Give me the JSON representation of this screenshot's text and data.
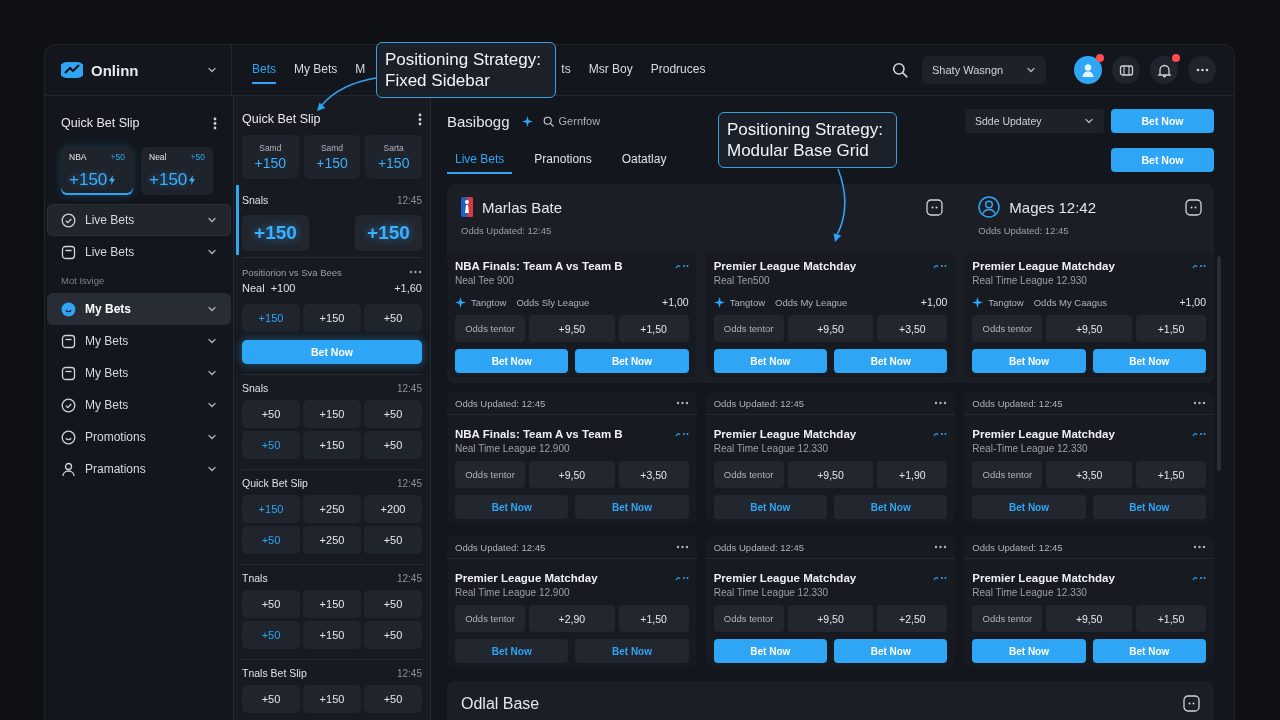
{
  "topbar": {
    "brand": "Onlinn",
    "nav": [
      {
        "label": "Bets",
        "selected": true
      },
      {
        "label": "My Bets",
        "selected": false
      },
      {
        "label": "M",
        "selected": false
      },
      {
        "label": "ts",
        "selected": false
      },
      {
        "label": "Msr Boy",
        "selected": false
      },
      {
        "label": "Prodruces",
        "selected": false
      }
    ],
    "user": "Shaty Wasngn",
    "icons": [
      {
        "kind": "avatar",
        "badge": true
      },
      {
        "kind": "ticket",
        "badge": false
      },
      {
        "kind": "bell",
        "badge": true
      },
      {
        "kind": "more",
        "badge": false
      }
    ]
  },
  "sidebar": {
    "title": "Quick Bet Slip",
    "tiles": [
      {
        "label": "NBA",
        "change": "+50",
        "odds": "+150",
        "selected": true
      },
      {
        "label": "Neal",
        "change": "+50",
        "odds": "+150",
        "selected": false
      }
    ],
    "items": [
      {
        "kind": "link",
        "label": "Live Bets",
        "selected": false,
        "highlighted": true
      },
      {
        "kind": "link",
        "label": "Live Bets",
        "selected": false,
        "highlighted": false
      },
      {
        "kind": "heading",
        "label": "Mot Isvige"
      },
      {
        "kind": "link",
        "label": "My Bets",
        "selected": true,
        "highlighted": false
      },
      {
        "kind": "link",
        "label": "My Bets",
        "selected": false,
        "highlighted": false
      },
      {
        "kind": "link",
        "label": "My Bets",
        "selected": false,
        "highlighted": false
      },
      {
        "kind": "link",
        "label": "My Bets",
        "selected": false,
        "highlighted": false
      },
      {
        "kind": "link",
        "label": "Promotions",
        "selected": false,
        "highlighted": false
      },
      {
        "kind": "link",
        "label": "Pramations",
        "selected": false,
        "highlighted": false
      }
    ]
  },
  "slip": {
    "title": "Quick Bet Slip",
    "tiles": [
      {
        "label": "Samd",
        "odds": "+150"
      },
      {
        "label": "Samd",
        "odds": "+150"
      },
      {
        "label": "Sarta",
        "odds": "+150"
      }
    ],
    "featured": {
      "title": "Snals",
      "time": "12:45",
      "odds": [
        "+150",
        "+150"
      ]
    },
    "position": {
      "title": "Positiorion vs Sva Bees",
      "pick": "Neal",
      "pick_odds": "+100",
      "total": "+1,60",
      "odds": [
        {
          "value": "+150",
          "selected": true
        },
        {
          "value": "+150",
          "selected": false
        },
        {
          "value": "+50",
          "selected": false
        }
      ],
      "button": "Bet Now"
    },
    "groups": [
      {
        "title": "Snals",
        "time": "12:45",
        "rows": [
          [
            {
              "value": "+50",
              "selected": false
            },
            {
              "value": "+150",
              "selected": false
            },
            {
              "value": "+50",
              "selected": false
            }
          ],
          [
            {
              "value": "+50",
              "selected": true
            },
            {
              "value": "+150",
              "selected": false
            },
            {
              "value": "+50",
              "selected": false
            }
          ]
        ]
      },
      {
        "title": "Quick Bet Slip",
        "time": "12:45",
        "rows": [
          [
            {
              "value": "+150",
              "selected": true
            },
            {
              "value": "+250",
              "selected": false
            },
            {
              "value": "+200",
              "selected": false
            }
          ],
          [
            {
              "value": "+50",
              "selected": true
            },
            {
              "value": "+250",
              "selected": false
            },
            {
              "value": "+50",
              "selected": false
            }
          ]
        ]
      },
      {
        "title": "Tnals",
        "time": "12:45",
        "rows": [
          [
            {
              "value": "+50",
              "selected": false
            },
            {
              "value": "+150",
              "selected": false
            },
            {
              "value": "+50",
              "selected": false
            }
          ],
          [
            {
              "value": "+50",
              "selected": true
            },
            {
              "value": "+150",
              "selected": false
            },
            {
              "value": "+50",
              "selected": false
            }
          ]
        ]
      },
      {
        "title": "Tnals Bet Slip",
        "time": "12:45",
        "rows": [
          [
            {
              "value": "+50",
              "selected": false
            },
            {
              "value": "+150",
              "selected": false
            },
            {
              "value": "+50",
              "selected": false
            }
          ]
        ]
      }
    ]
  },
  "main": {
    "title": "Basibogg",
    "search": "Gernfow",
    "select": "Sdde Updatey",
    "buttons": [
      "Bet Now",
      "Bet Now"
    ],
    "tabs": [
      {
        "label": "Live Bets",
        "selected": true
      },
      {
        "label": "Pranotions",
        "selected": false
      },
      {
        "label": "Oatatlay",
        "selected": false
      }
    ],
    "panel_headers": [
      {
        "kind": "league",
        "title": "Marlas Bate",
        "updated": "Odds Updated: 12:45"
      },
      {
        "kind": "user",
        "title": "Mages 12:42",
        "updated": "Odds Updated: 12:45"
      }
    ],
    "card_rows": [
      [
        {
          "title": "NBA Finals: Team A vs Team B",
          "subtitle": "Neal Tee 900",
          "meta": {
            "tag": "Tangtow",
            "league": "Odds Sly League",
            "value": "+1,00"
          },
          "odds": [
            "Odds tentor",
            "+9,50",
            "+1,50"
          ],
          "buttons": [
            "Bet Now",
            "Bet Now"
          ],
          "kind": "filled"
        },
        {
          "title": "Premier League Matchday",
          "subtitle": "Real Ten500",
          "meta": {
            "tag": "Tangtow",
            "league": "Odds My League",
            "value": "+1,00"
          },
          "odds": [
            "Odds tentor",
            "+9,50",
            "+3,50"
          ],
          "buttons": [
            "Bet Now",
            "Bet Now"
          ],
          "kind": "filled"
        },
        {
          "title": "Premier League Matchday",
          "subtitle": "Real Time League 12.930",
          "meta": {
            "tag": "Tangtow",
            "league": "Odds My Caagus",
            "value": "+1,00"
          },
          "odds": [
            "Odds tentor",
            "+9,50",
            "+1,50"
          ],
          "buttons": [
            "Bet Now",
            "Bet Now"
          ],
          "kind": "filled"
        }
      ],
      [
        {
          "updated": "Odds Updated: 12:45",
          "title": "NBA Finals: Team A vs Team B",
          "subtitle": "Neal Time League 12.900",
          "odds": [
            "Odds tentor",
            "+9,50",
            "+3,50"
          ],
          "buttons": [
            "Bet Now",
            "Bet Now"
          ],
          "kind": "subtle"
        },
        {
          "updated": "Odds Updated: 12:45",
          "title": "Premier League Matchday",
          "subtitle": "Real Time League 12.330",
          "odds": [
            "Odds tentor",
            "+9,50",
            "+1,90"
          ],
          "buttons": [
            "Bet Now",
            "Bet Now"
          ],
          "kind": "subtle"
        },
        {
          "updated": "Odds Updated: 12:45",
          "title": "Premier League Matchday",
          "subtitle": "Real-Time League 12.330",
          "odds": [
            "Odds tentor",
            "+3,50",
            "+1,50"
          ],
          "buttons": [
            "Bet Now",
            "Bet Now"
          ],
          "kind": "subtle"
        }
      ],
      [
        {
          "updated": "Odds Updated: 12:45",
          "title": "Premier League Matchday",
          "subtitle": "Real Time League 12.900",
          "odds": [
            "Odds tentor",
            "+2,90",
            "+1,50"
          ],
          "buttons": [
            "Bet Now",
            "Bet Now"
          ],
          "kind": "subtle"
        },
        {
          "updated": "Odds Updated: 12:45",
          "title": "Premier League Matchday",
          "subtitle": "Real Time League 12.330",
          "odds": [
            "Odds tentor",
            "+9,50",
            "+2,50"
          ],
          "buttons": [
            "Bet Now",
            "Bet Now"
          ],
          "kind": "filled"
        },
        {
          "updated": "Odds Updated: 12:45",
          "title": "Premier League Matchday",
          "subtitle": "Real Time League 12.330",
          "odds": [
            "Odds tentor",
            "+9,50",
            "+1,50"
          ],
          "buttons": [
            "Bet Now",
            "Bet Now"
          ],
          "kind": "filled"
        }
      ]
    ],
    "footer_panel": {
      "title": "Odlal Base"
    }
  },
  "annotations": [
    {
      "text": "Positioning Strategy: Fixed Sidebar"
    },
    {
      "text": "Positioning Strategy: Modular Base Grid"
    }
  ]
}
